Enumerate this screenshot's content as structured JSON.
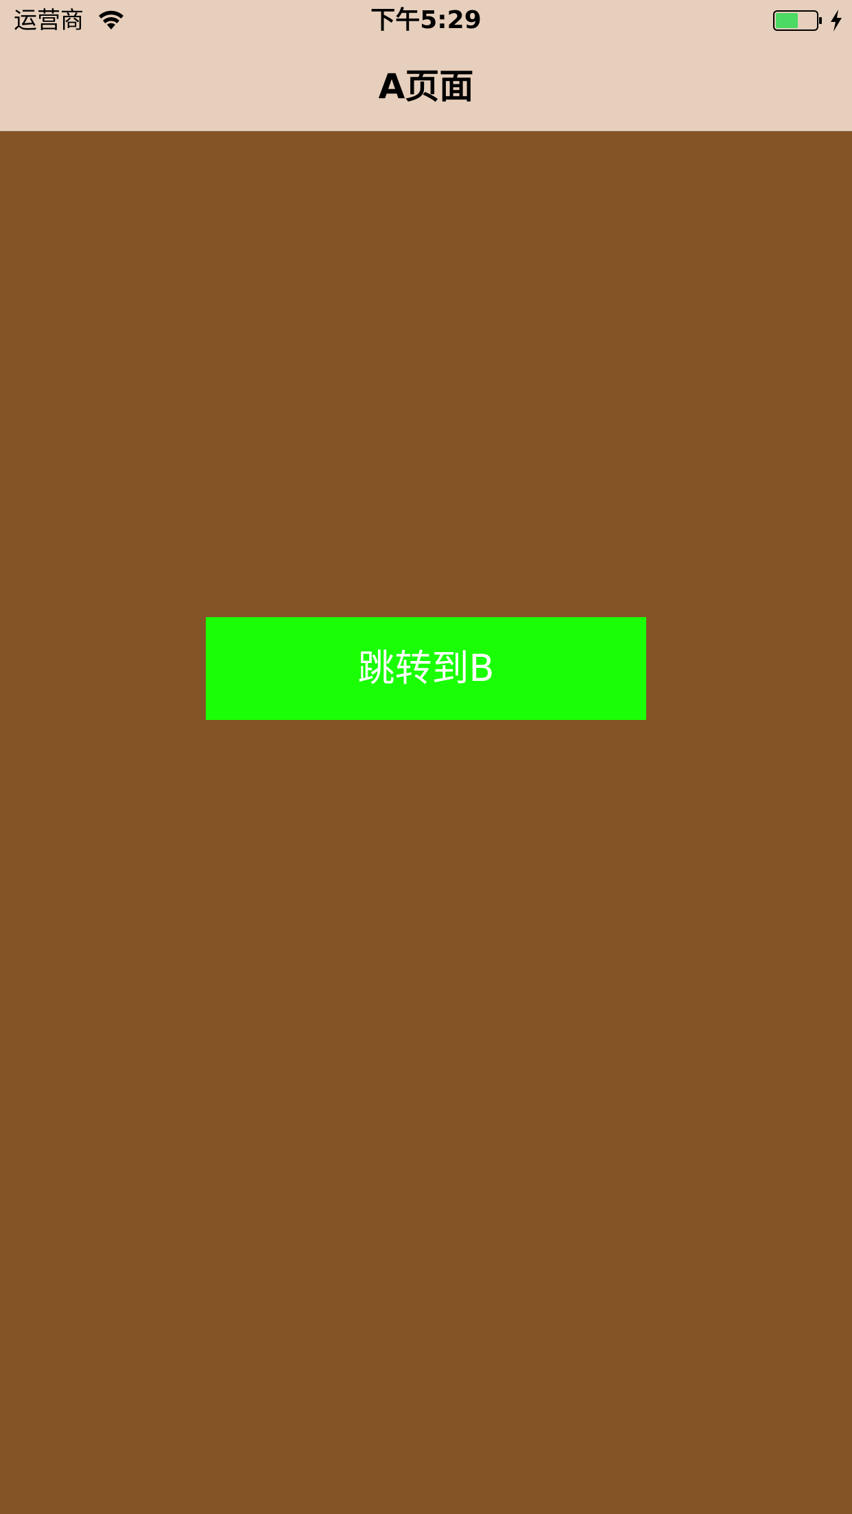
{
  "status_bar": {
    "carrier": "运营商",
    "time": "下午5:29",
    "wifi_icon": "wifi-icon",
    "battery_icon": "battery-icon",
    "battery_level": 0.55,
    "battery_color": "#4cd964",
    "charging_icon": "charging-bolt-icon"
  },
  "nav_bar": {
    "title": "A页面",
    "background": "#e6cfbc"
  },
  "main": {
    "background": "#845326",
    "jump_button": {
      "label": "跳转到B",
      "background": "#1aff06",
      "text_color": "#ffffff"
    }
  }
}
